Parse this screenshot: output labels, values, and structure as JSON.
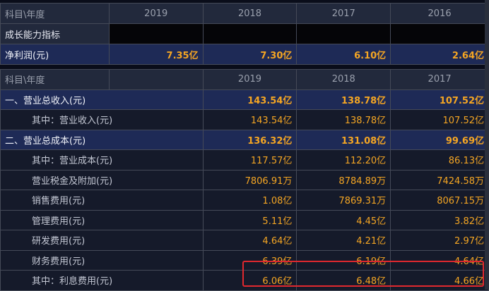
{
  "top_table": {
    "header": {
      "label": "科目\\年度",
      "years": [
        "2019",
        "2018",
        "2017",
        "2016"
      ]
    },
    "section_label": "成长能力指标",
    "net_profit": {
      "label": "净利润(元)",
      "values": [
        "7.35亿",
        "7.30亿",
        "6.10亿",
        "2.64亿"
      ]
    }
  },
  "main_table": {
    "header": {
      "label": "科目\\年度",
      "years": [
        "2019",
        "2018",
        "2017"
      ]
    },
    "rows": [
      {
        "label": "一、营业总收入(元)",
        "values": [
          "143.54亿",
          "138.78亿",
          "107.52亿"
        ]
      },
      {
        "label": "其中：营业收入(元)",
        "values": [
          "143.54亿",
          "138.78亿",
          "107.52亿"
        ]
      },
      {
        "label": "二、营业总成本(元)",
        "values": [
          "136.32亿",
          "131.08亿",
          "99.69亿"
        ]
      },
      {
        "label": "其中：营业成本(元)",
        "values": [
          "117.57亿",
          "112.20亿",
          "86.13亿"
        ]
      },
      {
        "label": "营业税金及附加(元)",
        "values": [
          "7806.91万",
          "8784.89万",
          "7424.58万"
        ]
      },
      {
        "label": "销售费用(元)",
        "values": [
          "1.08亿",
          "7869.31万",
          "8067.15万"
        ]
      },
      {
        "label": "管理费用(元)",
        "values": [
          "5.11亿",
          "4.45亿",
          "3.82亿"
        ]
      },
      {
        "label": "研发费用(元)",
        "values": [
          "4.64亿",
          "4.21亿",
          "2.97亿"
        ]
      },
      {
        "label": "财务费用(元)",
        "values": [
          "6.39亿",
          "6.19亿",
          "4.64亿"
        ]
      },
      {
        "label": "其中：利息费用(元)",
        "values": [
          "6.06亿",
          "6.48亿",
          "4.66亿"
        ]
      }
    ]
  },
  "colors": {
    "value": "#f5a623",
    "highlight_box": "#e0282e",
    "summary_row": "#1e2a56"
  }
}
